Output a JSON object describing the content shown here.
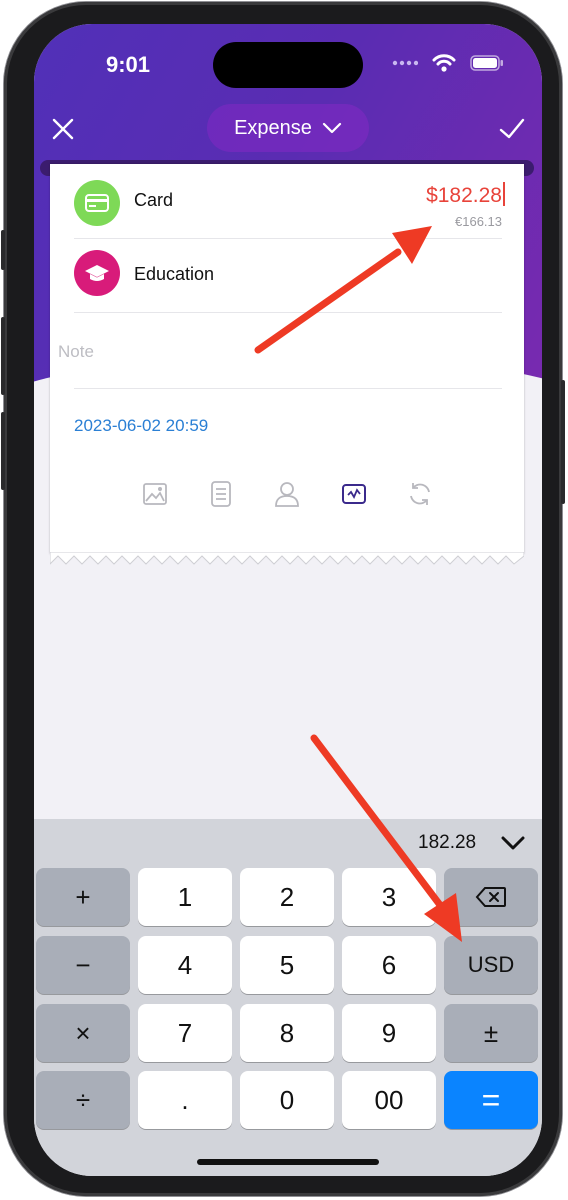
{
  "status_bar": {
    "time": "9:01"
  },
  "header": {
    "type_label": "Expense",
    "colors": {
      "gradient_start": "#5130b8",
      "gradient_end": "#7a2ab0"
    }
  },
  "transaction": {
    "account": {
      "label": "Card",
      "icon": "credit-card-icon",
      "color": "#7ed957"
    },
    "amount": "$182.28",
    "converted_amount": "€166.13",
    "category": {
      "label": "Education",
      "icon": "graduation-cap-icon",
      "color": "#d81b7a"
    },
    "note_placeholder": "Note",
    "datetime": "2023-06-02 20:59"
  },
  "toolbar_icons": [
    "image-icon",
    "document-icon",
    "person-icon",
    "receipt-icon",
    "repeat-icon"
  ],
  "keypad": {
    "display_value": "182.28",
    "rows": [
      [
        "+",
        "1",
        "2",
        "3",
        "⌫"
      ],
      [
        "−",
        "4",
        "5",
        "6",
        "USD"
      ],
      [
        "×",
        "7",
        "8",
        "9",
        "±"
      ],
      [
        "÷",
        ".",
        "0",
        "00",
        "="
      ]
    ],
    "colors": {
      "equals": "#0a84ff",
      "operator": "#a9aeb8"
    }
  },
  "annotation_color": "#ee3a24"
}
